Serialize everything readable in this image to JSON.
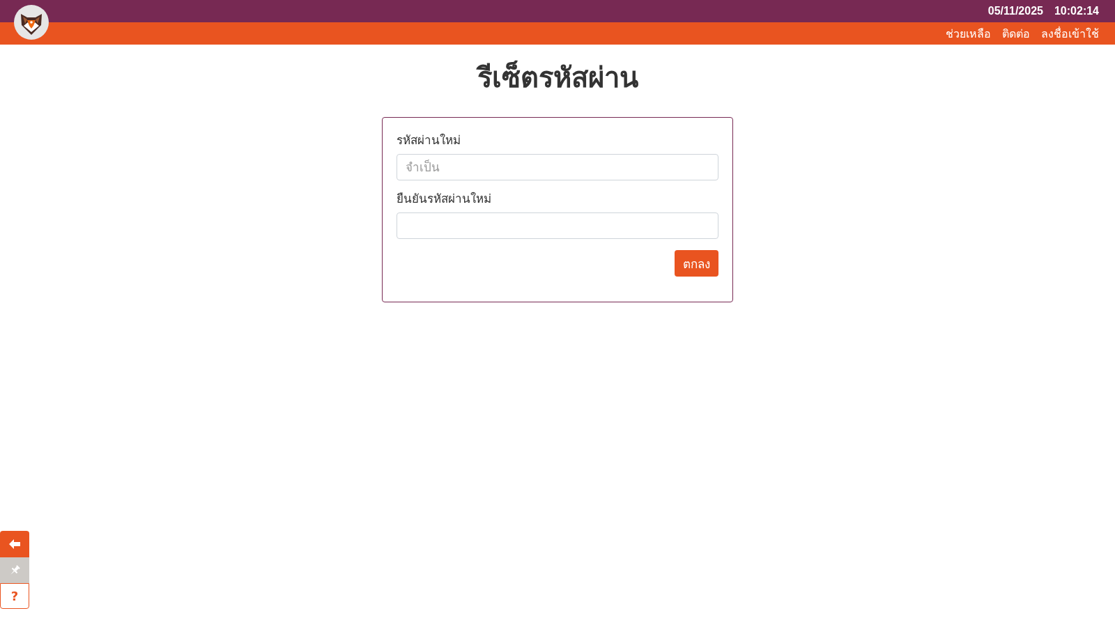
{
  "header": {
    "date": "05/11/2025",
    "time": "10:02:14",
    "nav_links": [
      "ช่วยเหลือ",
      "ติดต่อ",
      "ลงชื่อเข้าใช้"
    ]
  },
  "title": "รีเซ็ตรหัสผ่าน",
  "form": {
    "fields": [
      {
        "label": "รหัสผ่านใหม่",
        "placeholder": "จำเป็น"
      },
      {
        "label": "ยืนยันรหัสผ่านใหม่"
      }
    ],
    "submit_button": "ตกลง"
  },
  "side_buttons": [
    {
      "kind": "back"
    },
    {
      "kind": "pin"
    },
    {
      "kind": "help",
      "label": "?"
    }
  ]
}
